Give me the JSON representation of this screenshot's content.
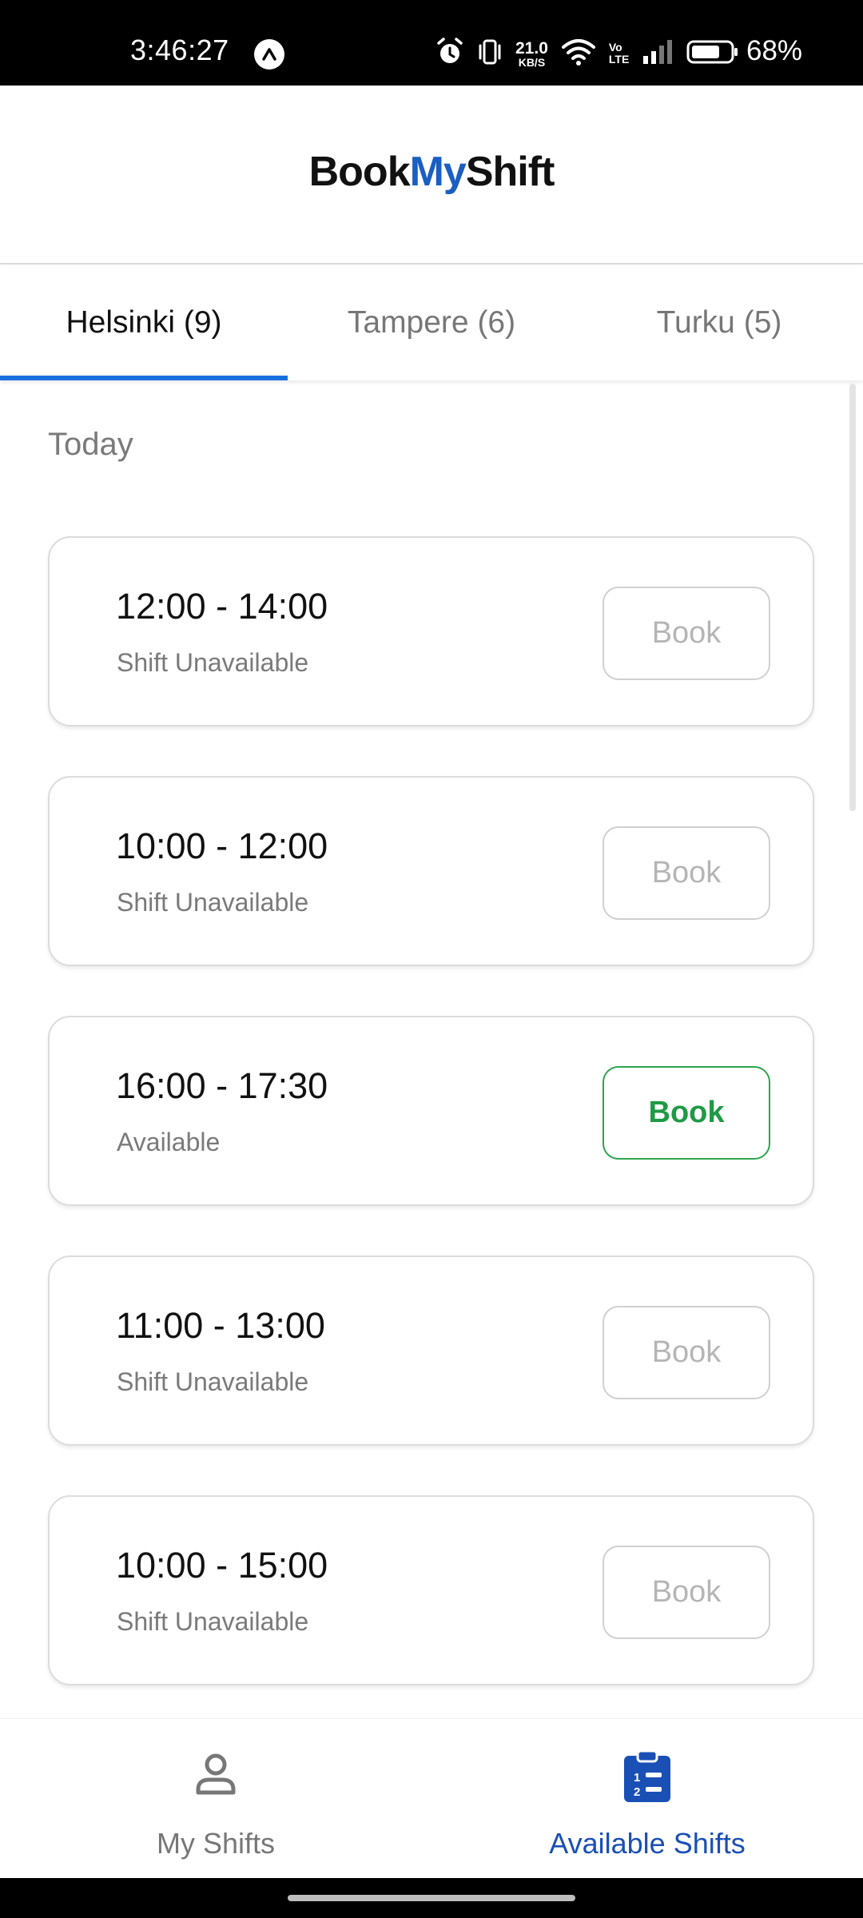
{
  "status_bar": {
    "time": "3:46:27",
    "net_speed_value": "21.0",
    "net_speed_unit": "KB/S",
    "volte_top": "Vo",
    "volte_bottom": "LTE",
    "battery_percent": "68%",
    "icons": [
      "app-icon",
      "alarm-icon",
      "vibrate-icon",
      "wifi-icon",
      "signal-icon",
      "battery-icon"
    ]
  },
  "header": {
    "logo_part1": "Book",
    "logo_part2": "My",
    "logo_part3": "Shift",
    "accent_color": "#1a5fc1"
  },
  "tabs": [
    {
      "label": "Helsinki (9)",
      "active": true
    },
    {
      "label": "Tampere (6)",
      "active": false
    },
    {
      "label": "Turku (5)",
      "active": false
    }
  ],
  "section": {
    "title": "Today"
  },
  "shifts": [
    {
      "time": "12:00 - 14:00",
      "status": "Shift Unavailable",
      "button": "Book",
      "available": false
    },
    {
      "time": "10:00 - 12:00",
      "status": "Shift Unavailable",
      "button": "Book",
      "available": false
    },
    {
      "time": "16:00 - 17:30",
      "status": "Available",
      "button": "Book",
      "available": true
    },
    {
      "time": "11:00 - 13:00",
      "status": "Shift Unavailable",
      "button": "Book",
      "available": false
    },
    {
      "time": "10:00 - 15:00",
      "status": "Shift Unavailable",
      "button": "Book",
      "available": false
    }
  ],
  "bottom_nav": {
    "items": [
      {
        "label": "My Shifts",
        "icon": "person-icon",
        "active": false
      },
      {
        "label": "Available Shifts",
        "icon": "clipboard-list-icon",
        "active": true
      }
    ]
  },
  "colors": {
    "available_green": "#1f9a45",
    "active_tab_underline": "#1a6fe0",
    "active_nav": "#1a4fb5"
  }
}
